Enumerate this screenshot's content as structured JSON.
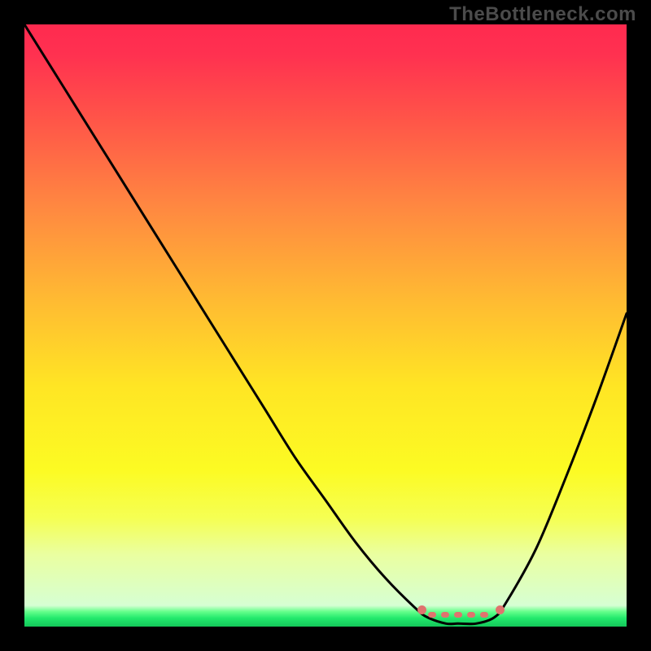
{
  "watermark": "TheBottleneck.com",
  "chart_data": {
    "type": "line",
    "title": "",
    "xlabel": "",
    "ylabel": "",
    "xlim": [
      0,
      100
    ],
    "ylim": [
      0,
      100
    ],
    "grid": false,
    "series": [
      {
        "name": "bottleneck-curve",
        "x": [
          0,
          5,
          10,
          15,
          20,
          25,
          30,
          35,
          40,
          45,
          50,
          55,
          60,
          65,
          67,
          70,
          72,
          75,
          78,
          80,
          85,
          90,
          95,
          100
        ],
        "values": [
          100,
          92,
          84,
          76,
          68,
          60,
          52,
          44,
          36,
          28,
          21,
          14,
          8,
          3,
          1.5,
          0.5,
          0.5,
          0.5,
          1.5,
          4,
          13,
          25,
          38,
          52
        ]
      }
    ],
    "annotations": [
      {
        "name": "optimal-range",
        "type": "flat-segment",
        "x_start": 66,
        "x_end": 79,
        "y": 2,
        "color": "#e0736e"
      }
    ],
    "background_gradient": {
      "stops": [
        {
          "pos": 0.0,
          "color": "#ff2a4f"
        },
        {
          "pos": 0.05,
          "color": "#ff3150"
        },
        {
          "pos": 0.15,
          "color": "#ff5249"
        },
        {
          "pos": 0.3,
          "color": "#ff8741"
        },
        {
          "pos": 0.45,
          "color": "#ffb833"
        },
        {
          "pos": 0.6,
          "color": "#ffe524"
        },
        {
          "pos": 0.74,
          "color": "#fcfb23"
        },
        {
          "pos": 0.82,
          "color": "#f5ff53"
        },
        {
          "pos": 0.88,
          "color": "#eaffa0"
        },
        {
          "pos": 0.965,
          "color": "#d6ffd3"
        },
        {
          "pos": 0.975,
          "color": "#66ff8c"
        },
        {
          "pos": 0.986,
          "color": "#22e96c"
        },
        {
          "pos": 1.0,
          "color": "#14c75a"
        }
      ]
    }
  }
}
